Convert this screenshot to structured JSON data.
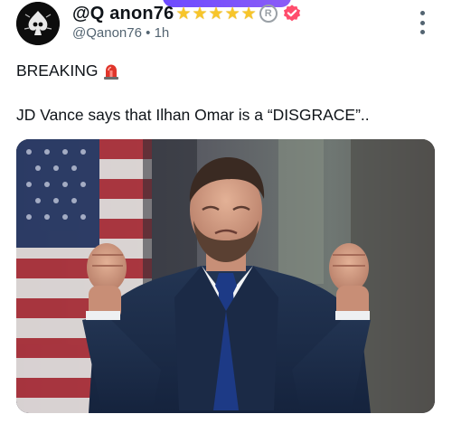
{
  "post": {
    "author": {
      "display_name": "@Q anon76",
      "handle": "@Qanon76",
      "separator": "•",
      "timestamp": "1h",
      "star_count": 5,
      "verified_badge_color": "#ff4d6d",
      "reg_symbol": "R"
    },
    "text": {
      "breaking_label": "BREAKING",
      "body": "JD Vance says that Ilhan Omar is a “DISGRACE”.."
    },
    "icons": {
      "avatar": "spade-skull-avatar-icon",
      "stars": "star-icon",
      "verified": "verified-badge-icon",
      "more": "more-options-icon",
      "siren": "siren-emoji-icon"
    },
    "media": {
      "image_type": "photo"
    }
  }
}
